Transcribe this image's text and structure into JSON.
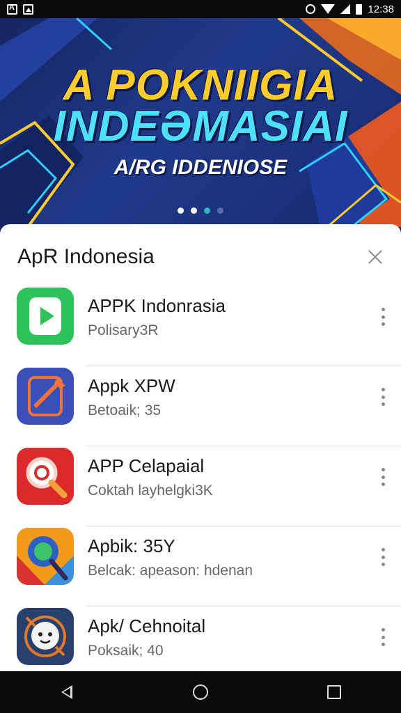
{
  "status_bar": {
    "time": "12:38",
    "left_icons": [
      "a-icon",
      "image-icon"
    ],
    "right_icons": [
      "alarm-icon",
      "wifi-icon",
      "signal-icon",
      "battery-icon"
    ]
  },
  "banner": {
    "title_line1": "A POKNIIGIA",
    "title_line2": "INDEƏMASIAI",
    "subtitle": "A/RG IDDENIOSE",
    "dots_total": 4,
    "active_dot": 2
  },
  "sheet": {
    "title": "ApR Indonesia",
    "apps": [
      {
        "name": "APPK Indonrasia",
        "subtitle": "Polisary3R",
        "icon": "play-icon",
        "color": "#2ec25a"
      },
      {
        "name": "Appk XPW",
        "subtitle": "Betoaik; 35",
        "icon": "document-pencil-icon",
        "color": "#3b4fb8"
      },
      {
        "name": "APP Celapaial",
        "subtitle": "Coktah layhelgki3K",
        "icon": "magnifier-icon",
        "color": "#dc2a2a"
      },
      {
        "name": "Apbik: 35Y",
        "subtitle": "Belcak: apeason: hdenan",
        "icon": "palette-icon",
        "color": "#f29a1c"
      },
      {
        "name": "Apk/ Cehnoital",
        "subtitle": "Poksaik; 40",
        "icon": "mascot-icon",
        "color": "#27406e"
      }
    ]
  },
  "nav_bar": {
    "buttons": [
      "back-icon",
      "home-icon",
      "recents-icon"
    ]
  }
}
